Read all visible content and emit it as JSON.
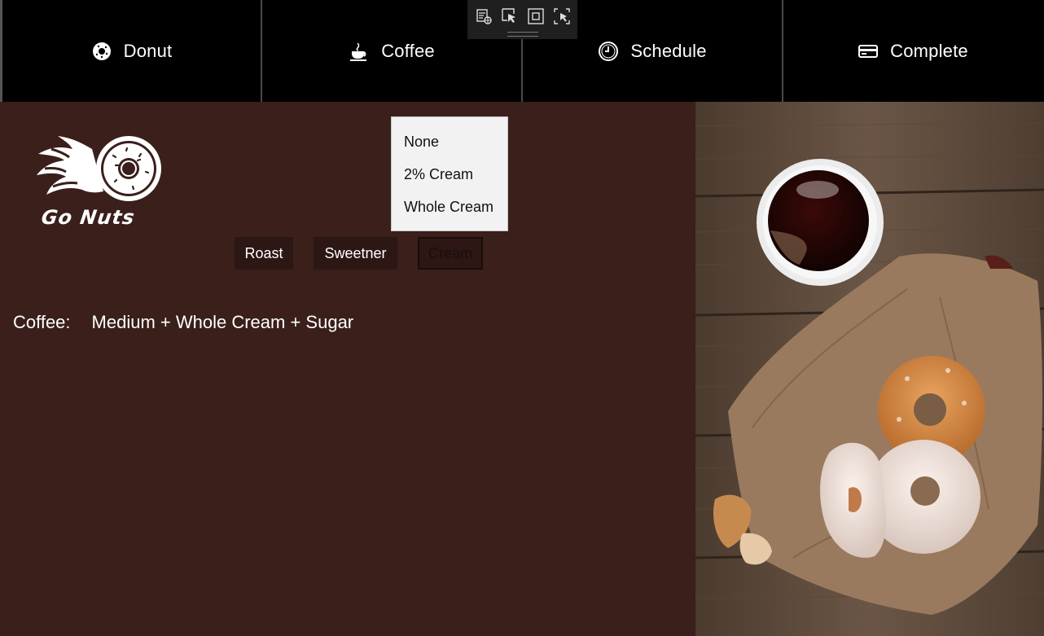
{
  "nav": {
    "tabs": [
      {
        "label": "Donut",
        "icon": "donut-icon"
      },
      {
        "label": "Coffee",
        "icon": "coffee-cup-icon"
      },
      {
        "label": "Schedule",
        "icon": "clock-icon"
      },
      {
        "label": "Complete",
        "icon": "card-icon"
      }
    ]
  },
  "devbar": {
    "icons": [
      "live-tree-icon",
      "select-element-icon",
      "display-layout-icon",
      "track-focus-icon"
    ]
  },
  "brand": {
    "logo_text": "Go Nuts"
  },
  "options": {
    "roast_label": "Roast",
    "sweetner_label": "Sweetner",
    "cream_label": "Cream"
  },
  "cream_menu": {
    "items": [
      "None",
      "2% Cream",
      "Whole Cream"
    ]
  },
  "summary": {
    "label": "Coffee:",
    "value": "Medium + Whole Cream + Sugar"
  },
  "colors": {
    "background": "#3a1f1b",
    "nav_background": "#000000",
    "button_background": "#2c1714",
    "flyout_background": "#f2f2f2"
  }
}
